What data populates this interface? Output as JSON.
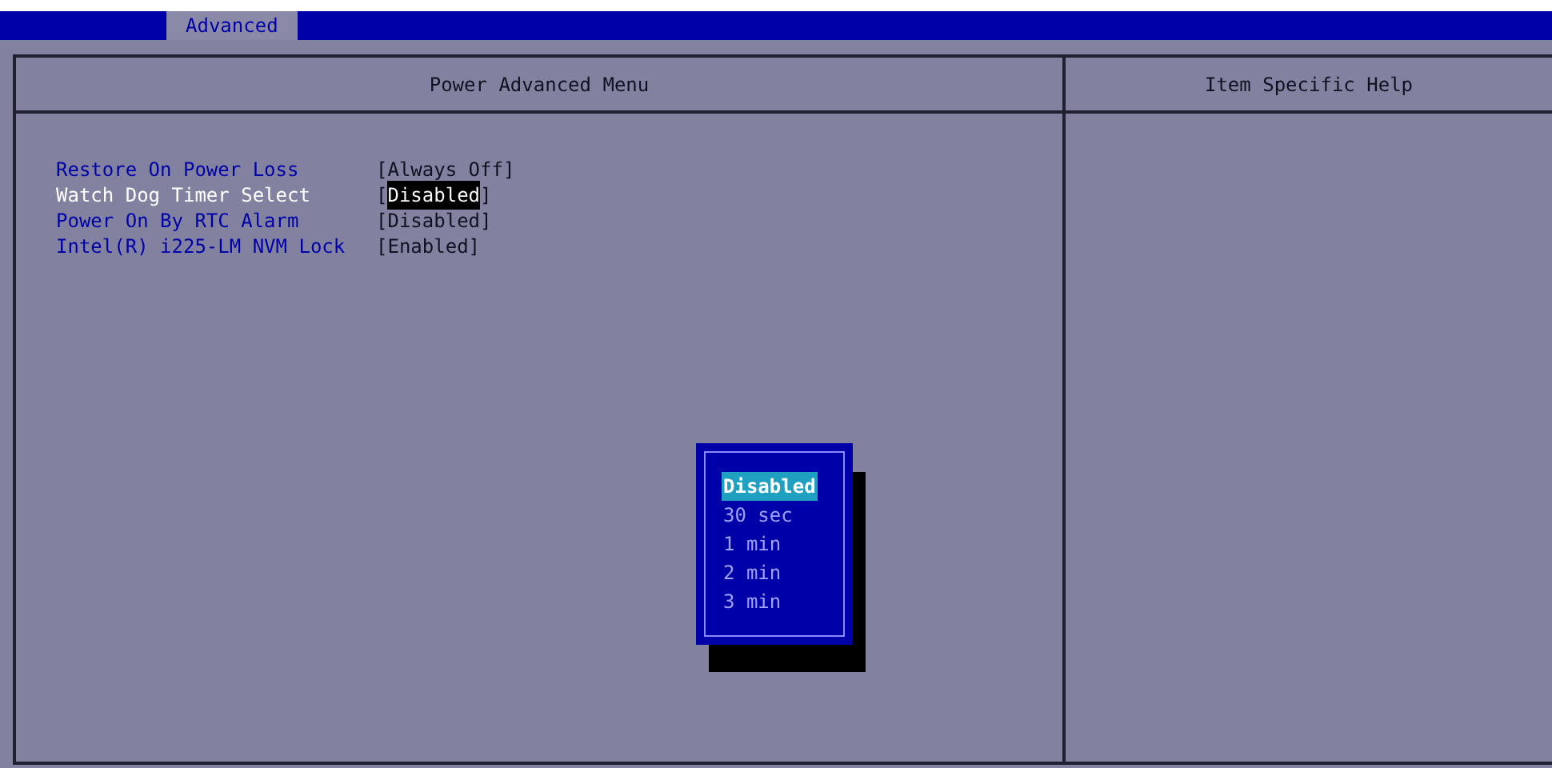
{
  "tabs": [
    {
      "label": "Advanced",
      "selected": true
    }
  ],
  "main_panel": {
    "title": "Power Advanced Menu",
    "items": [
      {
        "label": "Restore On Power Loss",
        "value": "[Always Off]",
        "selected": false
      },
      {
        "label": "Watch Dog Timer Select",
        "value": "[Disabled]",
        "selected": true
      },
      {
        "label": "Power On By RTC Alarm",
        "value": "[Disabled]",
        "selected": false
      },
      {
        "label": "Intel(R) i225-LM NVM Lock",
        "value": "[Enabled]",
        "selected": false
      }
    ]
  },
  "help_panel": {
    "title": "Item Specific Help"
  },
  "popup": {
    "options": [
      {
        "label": "Disabled",
        "selected": true
      },
      {
        "label": "30 sec",
        "selected": false
      },
      {
        "label": "1 min",
        "selected": false
      },
      {
        "label": "2 min",
        "selected": false
      },
      {
        "label": "3 min",
        "selected": false
      }
    ]
  }
}
